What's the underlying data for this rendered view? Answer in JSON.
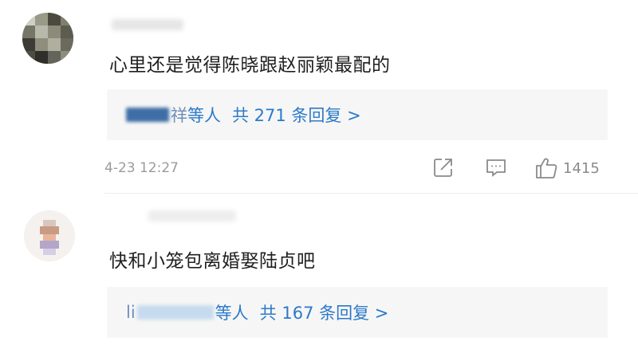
{
  "comments": [
    {
      "text": "心里还是觉得陈晓跟赵丽颖最配的",
      "replies_prefix": "祥",
      "replies_who": "等人",
      "replies_summary": "共 271 条回复 >",
      "timestamp": "4-23 12:27",
      "like_count": "1415"
    },
    {
      "text": "快和小笼包离婚娶陆贞吧",
      "replies_prefix": "li",
      "replies_who": "等人",
      "replies_summary": "共 167 条回复 >"
    }
  ],
  "icons": {
    "share": "share-icon",
    "comment": "comment-icon",
    "like": "thumbs-up-icon"
  },
  "colors": {
    "link": "#2c7ac9",
    "meta": "#9b9b9b",
    "reply_bg": "#f6f6f6"
  }
}
